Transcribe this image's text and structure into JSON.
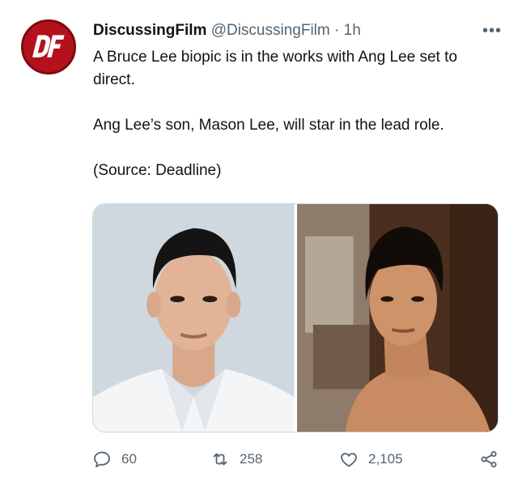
{
  "tweet": {
    "author_name": "DiscussingFilm",
    "handle": "@DiscussingFilm",
    "separator": "·",
    "time": "1h",
    "more_icon": "more-horizontal-icon",
    "avatar_text": "DF",
    "paragraphs": [
      "A Bruce Lee biopic is in the works with Ang Lee set to direct.",
      "Ang Lee’s son, Mason Lee, will star in the lead role.",
      "(Source: Deadline)"
    ],
    "media": [
      {
        "description": "portrait-photo-man-white-shirt"
      },
      {
        "description": "portrait-photo-bruce-lee"
      }
    ]
  },
  "actions": {
    "reply": {
      "icon": "reply-icon",
      "count": "60"
    },
    "retweet": {
      "icon": "retweet-icon",
      "count": "258"
    },
    "like": {
      "icon": "heart-icon",
      "count": "2,105"
    },
    "share": {
      "icon": "share-icon"
    }
  },
  "colors": {
    "avatar_red": "#b3121c",
    "text": "#0f1419",
    "muted": "#536471",
    "border": "#cfd9de"
  }
}
